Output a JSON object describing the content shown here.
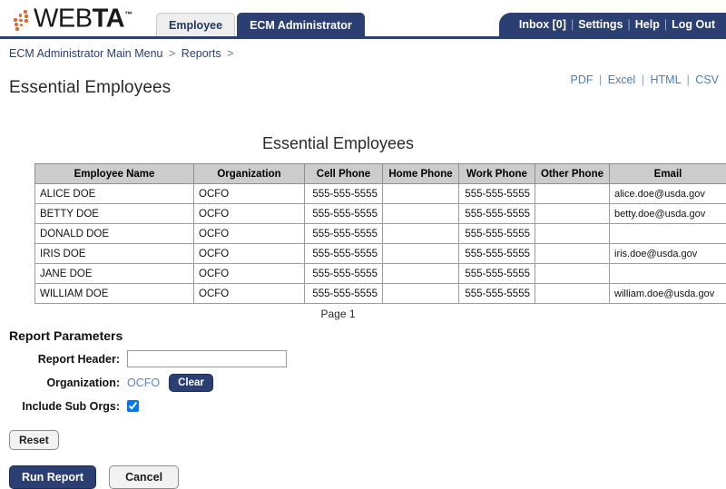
{
  "app": {
    "logo_text_thin": "WEB",
    "logo_text_bold": "TA",
    "logo_tm": "™"
  },
  "tabs": [
    {
      "label": "Employee",
      "active": false
    },
    {
      "label": "ECM Administrator",
      "active": true
    }
  ],
  "header_nav": {
    "inbox": "Inbox [0]",
    "settings": "Settings",
    "help": "Help",
    "logout": "Log Out",
    "separator": "|"
  },
  "breadcrumb": {
    "root": "ECM Administrator Main Menu",
    "sep1": ">",
    "level2": "Reports",
    "sep2": ">"
  },
  "export": {
    "pdf": "PDF",
    "excel": "Excel",
    "html": "HTML",
    "csv": "CSV",
    "separator": "|"
  },
  "page": {
    "title": "Essential Employees"
  },
  "report": {
    "title": "Essential Employees",
    "page_label": "Page 1",
    "columns": [
      "Employee Name",
      "Organization",
      "Cell Phone",
      "Home Phone",
      "Work Phone",
      "Other Phone",
      "Email"
    ],
    "rows": [
      {
        "name": "ALICE DOE",
        "organization": "OCFO",
        "cell_phone": "555-555-5555",
        "home_phone": "",
        "work_phone": "555-555-5555",
        "other_phone": "",
        "email": "alice.doe@usda.gov"
      },
      {
        "name": "BETTY DOE",
        "organization": "OCFO",
        "cell_phone": "555-555-5555",
        "home_phone": "",
        "work_phone": "555-555-5555",
        "other_phone": "",
        "email": "betty.doe@usda.gov"
      },
      {
        "name": "DONALD DOE",
        "organization": "OCFO",
        "cell_phone": "555-555-5555",
        "home_phone": "",
        "work_phone": "555-555-5555",
        "other_phone": "",
        "email": ""
      },
      {
        "name": "IRIS DOE",
        "organization": "OCFO",
        "cell_phone": "555-555-5555",
        "home_phone": "",
        "work_phone": "555-555-5555",
        "other_phone": "",
        "email": "iris.doe@usda.gov"
      },
      {
        "name": "JANE DOE",
        "organization": "OCFO",
        "cell_phone": "555-555-5555",
        "home_phone": "",
        "work_phone": "555-555-5555",
        "other_phone": "",
        "email": ""
      },
      {
        "name": "WILLIAM DOE",
        "organization": "OCFO",
        "cell_phone": "555-555-5555",
        "home_phone": "",
        "work_phone": "555-555-5555",
        "other_phone": "",
        "email": "william.doe@usda.gov"
      }
    ]
  },
  "params": {
    "heading": "Report Parameters",
    "report_header_label": "Report Header:",
    "report_header_value": "",
    "report_header_placeholder": "",
    "organization_label": "Organization:",
    "organization_value": "OCFO",
    "clear_label": "Clear",
    "include_sub_orgs_label": "Include Sub Orgs:",
    "include_sub_orgs_checked": true
  },
  "buttons": {
    "reset": "Reset",
    "run_report": "Run Report",
    "cancel": "Cancel"
  },
  "colors": {
    "navy": "#2b3f72",
    "link_blue": "#4a7fc1",
    "logo_orange": "#e8622a",
    "table_header_gray": "#cccccc"
  }
}
